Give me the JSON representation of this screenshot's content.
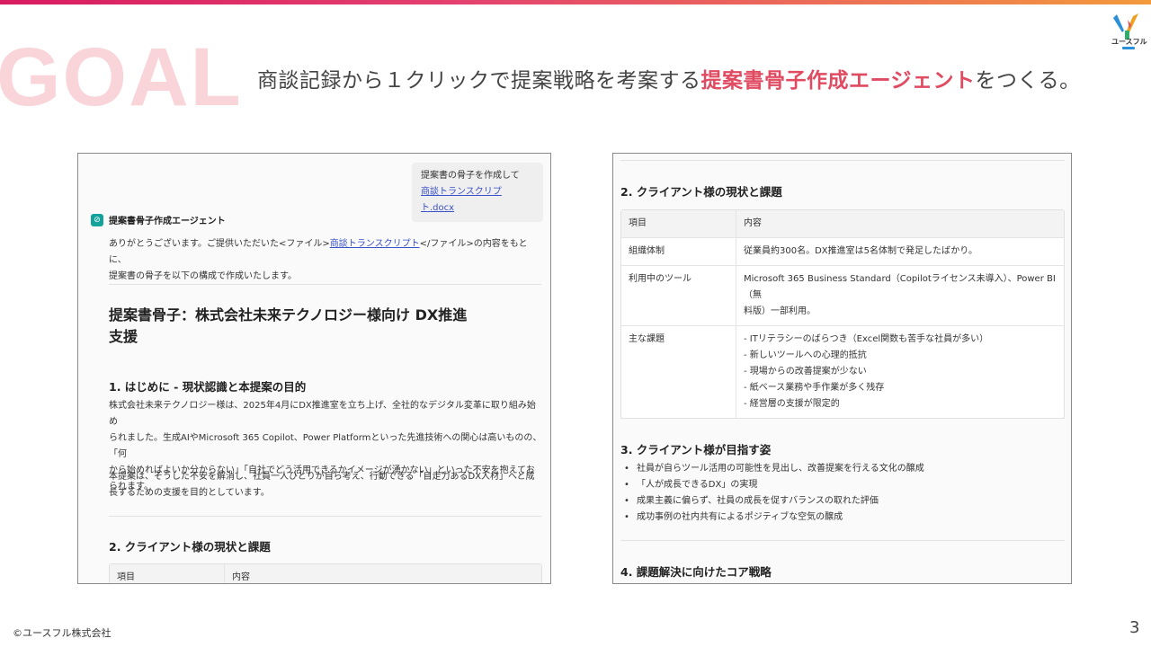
{
  "colors": {
    "accent": "#e04b62",
    "watermark": "#f9d4d9",
    "link": "#3a52c9",
    "agent_icon": "#14a39a"
  },
  "slide": {
    "watermark": "GOAL",
    "headline_pre": "商談記録から１クリックで提案戦略を考案する",
    "headline_accent": "提案書骨子作成エージェント",
    "headline_post": "をつくる。",
    "logo_text": "ユースフル",
    "footer": "©ユースフル株式会社",
    "page_number": "3"
  },
  "left": {
    "user_message": "提案書の骨子を作成して",
    "user_file": "商談トランスクリプト.docx",
    "agent_icon": "agent-icon",
    "agent_name": "提案書骨子作成エージェント",
    "intro_pre": "ありがとうございます。ご提供いただいた<ファイル>",
    "intro_link": "商談トランスクリプト",
    "intro_post": "</ファイル>の内容をもとに、",
    "intro_line2": "提案書の骨子を以下の構成で作成いたします。",
    "doc_title_1": "提案書骨子：株式会社未来テクノロジー様向け DX推進",
    "doc_title_2": "支援",
    "section1_title": "1. はじめに - 現状認識と本提案の目的",
    "section1_para1_l1": "株式会社未来テクノロジー様は、2025年4月にDX推進室を立ち上げ、全社的なデジタル変革に取り組み始め",
    "section1_para1_l2": "られました。生成AIやMicrosoft 365 Copilot、Power Platformといった先進技術への関心は高いものの、「何",
    "section1_para1_l3": "から始めればよいか分からない」「自社でどう活用できるかイメージが湧かない」といった不安を抱えてお",
    "section1_para1_l4": "られます。",
    "section1_para2_l1": "本提案は、そうした不安を解消し、社員一人ひとりが自ら考え、行動できる「自走力あるDX人材」へと成",
    "section1_para2_l2": "長するための支援を目的としています。",
    "section2_title": "2. クライアント様の現状と課題",
    "table_head": [
      "項目",
      "内容"
    ]
  },
  "right": {
    "section2_title": "2. クライアント様の現状と課題",
    "table": {
      "head": [
        "項目",
        "内容"
      ],
      "rows": [
        {
          "item": "組織体制",
          "lines": [
            "従業員約300名。DX推進室は5名体制で発足したばかり。"
          ]
        },
        {
          "item": "利用中のツール",
          "lines": [
            "Microsoft 365 Business Standard（Copilotライセンス未導入）、Power BI（無",
            "料版）一部利用。"
          ]
        },
        {
          "item": "主な課題",
          "lines": [
            "- ITリテラシーのばらつき（Excel関数も苦手な社員が多い）",
            "- 新しいツールへの心理的抵抗",
            "- 現場からの改善提案が少ない",
            "- 紙ベース業務や手作業が多く残存",
            "- 経営層の支援が限定的"
          ]
        }
      ]
    },
    "section3_title": "3. クライアント様が目指す姿",
    "section3_bullets": [
      "社員が自らツール活用の可能性を見出し、改善提案を行える文化の醸成",
      "「人が成長できるDX」の実現",
      "成果主義に偏らず、社員の成長を促すバランスの取れた評価",
      "成功事例の社内共有によるポジティブな空気の醸成"
    ],
    "section4_title": "4. 課題解決に向けたコア戦略"
  }
}
